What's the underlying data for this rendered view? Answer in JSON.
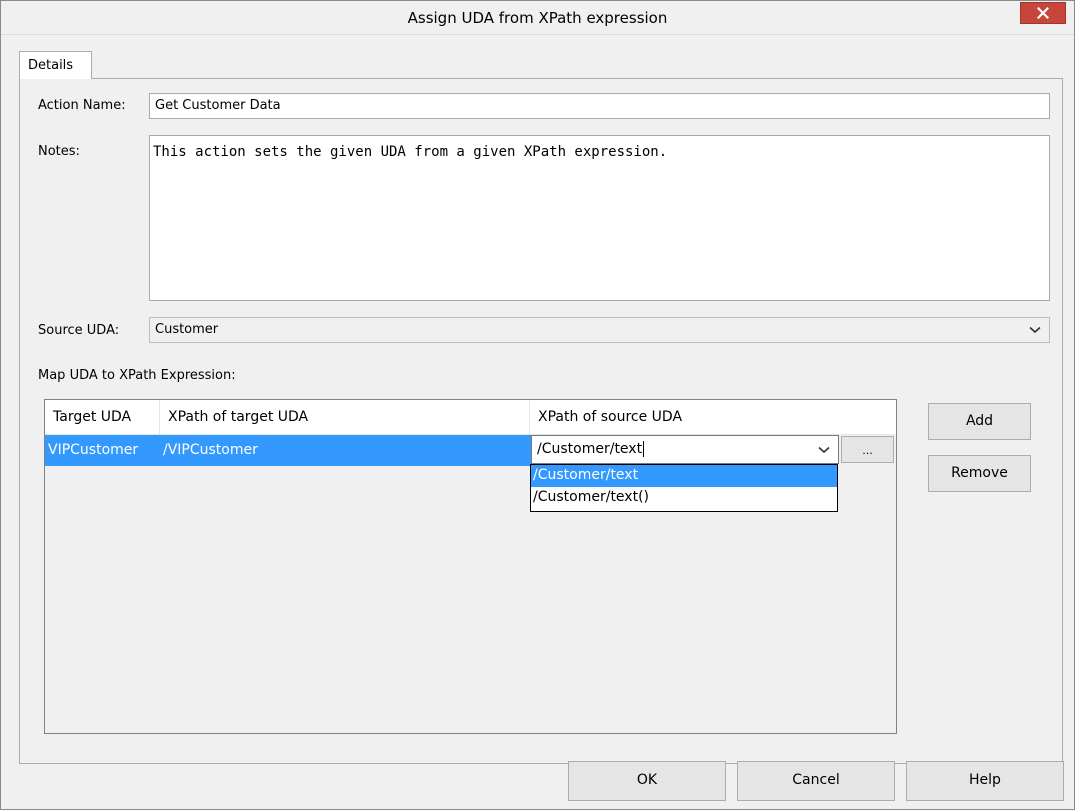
{
  "window": {
    "title": "Assign UDA from XPath expression",
    "close_icon": "close-icon"
  },
  "tabs": [
    {
      "label": "Details",
      "selected": true
    }
  ],
  "form": {
    "action_name_label": "Action Name:",
    "action_name_value": "Get Customer Data",
    "notes_label": "Notes:",
    "notes_value": "This action sets the given UDA from a given XPath expression.",
    "source_uda_label": "Source UDA:",
    "source_uda_value": "Customer",
    "map_label": "Map UDA to XPath Expression:"
  },
  "grid": {
    "columns": [
      "Target UDA",
      "XPath of target UDA",
      "XPath of source UDA"
    ],
    "rows": [
      {
        "target_uda": "VIPCustomer",
        "xpath_target": "/VIPCustomer",
        "xpath_source": "/Customer/text"
      }
    ],
    "ellipsis_label": "..."
  },
  "dropdown": {
    "options": [
      "/Customer/text",
      "/Customer/text()"
    ],
    "highlighted_index": 0
  },
  "side_buttons": {
    "add": "Add",
    "remove": "Remove"
  },
  "footer_buttons": {
    "ok": "OK",
    "cancel": "Cancel",
    "help": "Help"
  },
  "colors": {
    "selection": "#3399ff",
    "close_button": "#c7463b"
  }
}
